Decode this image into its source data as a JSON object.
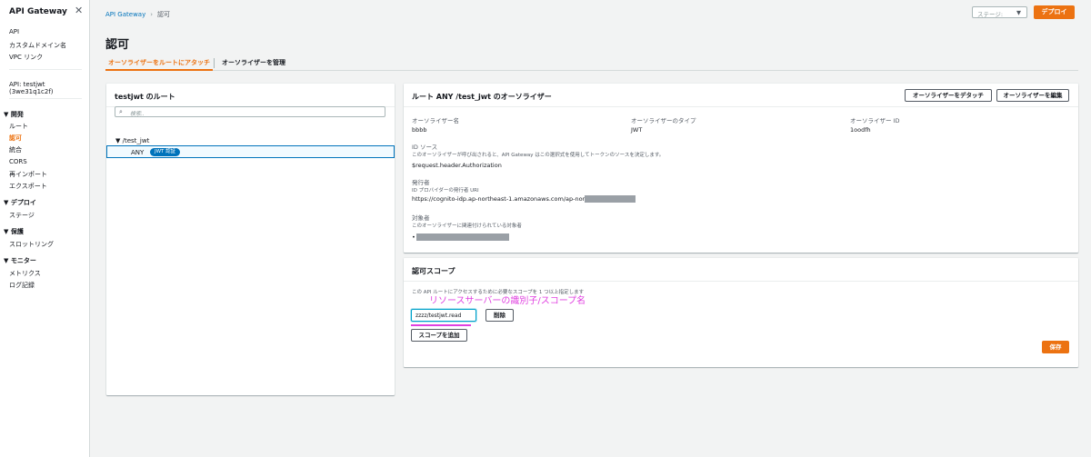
{
  "sidebar": {
    "title": "API Gateway",
    "links": [
      "API",
      "カスタムドメイン名",
      "VPC リンク"
    ],
    "api_label": "API: testjwt (3we31q1c2f)",
    "sections": [
      {
        "name": "開発",
        "items": [
          "ルート",
          "認可",
          "統合",
          "CORS",
          "再インポート",
          "エクスポート"
        ],
        "active": "認可"
      },
      {
        "name": "デプロイ",
        "items": [
          "ステージ"
        ]
      },
      {
        "name": "保護",
        "items": [
          "スロットリング"
        ]
      },
      {
        "name": "モニター",
        "items": [
          "メトリクス",
          "ログ記録"
        ]
      }
    ]
  },
  "header": {
    "breadcrumb": [
      "API Gateway",
      "認可"
    ],
    "stage_placeholder": "ステージ:",
    "deploy_label": "デプロイ",
    "page_title": "認可"
  },
  "tabs": [
    {
      "label": "オーソライザーをルートにアタッチ",
      "active": true
    },
    {
      "label": "オーソライザーを管理",
      "active": false
    }
  ],
  "routes_panel": {
    "title": "testjwt のルート",
    "search_placeholder": "検索..",
    "root_path": "▼ /test_jwt",
    "method": "ANY",
    "badge": "JWT 認証"
  },
  "authorizer_panel": {
    "title": "ルート ANY /test_jwt のオーソライザー",
    "detach_label": "オーソライザーをデタッチ",
    "edit_label": "オーソライザーを編集",
    "name_label": "オーソライザー名",
    "name_value": "bbbb",
    "type_label": "オーソライザーのタイプ",
    "type_value": "JWT",
    "id_label": "オーソライザー ID",
    "id_value": "1oodfh",
    "identity_label": "ID ソース",
    "identity_desc": "このオーソライザーが呼び出されると、API Gateway はこの選択式を使用してトークンのソースを決定します。",
    "identity_value": "$request.header.Authorization",
    "issuer_label": "発行者",
    "issuer_desc": "ID プロバイダーの発行者 URI",
    "issuer_value": "https://cognito-idp.ap-northeast-1.amazonaws.com/ap-northeast-1",
    "audience_label": "対象者",
    "audience_desc": "このオーソライザーに関連付けられている対象者",
    "audience_bullet": "•"
  },
  "scope_panel": {
    "title": "認可スコープ",
    "desc": "この API ルートにアクセスするために必要なスコープを 1 つ以上指定します",
    "annotation": "リソースサーバーの識別子/スコープ名",
    "scope_value": "zzzz/testjwt.read",
    "delete_label": "削除",
    "add_label": "スコープを追加",
    "save_label": "保存"
  },
  "colors": {
    "accent": "#ec7211",
    "link": "#0073bb",
    "annotation": "#e040e0"
  }
}
